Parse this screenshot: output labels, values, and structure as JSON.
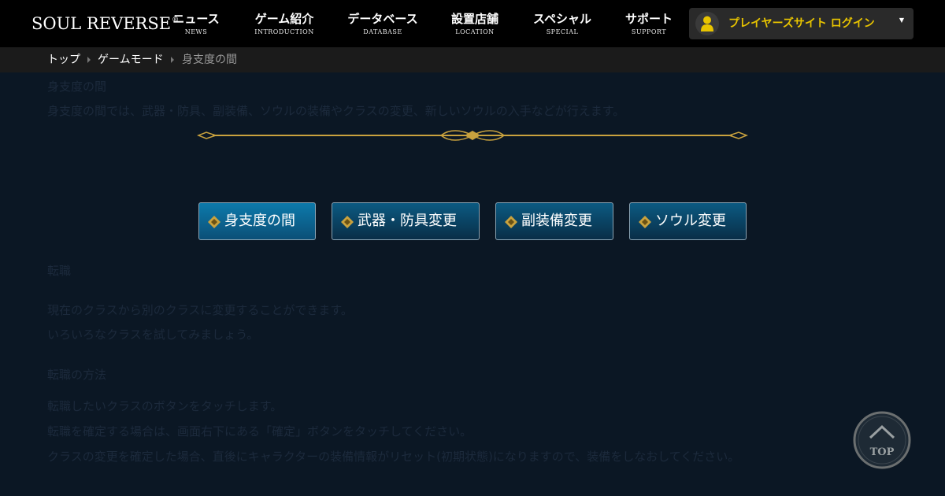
{
  "header": {
    "logo_text": "SOUL REVERSE",
    "logo_mark": "®",
    "nav": [
      {
        "jp": "ニュース",
        "en": "NEWS"
      },
      {
        "jp": "ゲーム紹介",
        "en": "INTRODUCTION"
      },
      {
        "jp": "データベース",
        "en": "DATABASE"
      },
      {
        "jp": "設置店舗",
        "en": "LOCATION"
      },
      {
        "jp": "スペシャル",
        "en": "SPECIAL"
      },
      {
        "jp": "サポート",
        "en": "SUPPORT"
      }
    ],
    "login_label": "プレイヤーズサイト ログイン",
    "login_caret": "▼"
  },
  "breadcrumb": [
    {
      "label": "トップ"
    },
    {
      "label": "ゲームモード"
    },
    {
      "label": "身支度の間"
    }
  ],
  "content": {
    "section_title": "身支度の間",
    "section_desc": "身支度の間では、武器・防具、副装備、ソウルの装備やクラスの変更、新しいソウルの入手などが行えます。",
    "tabs": [
      {
        "label": "身支度の間",
        "active": true
      },
      {
        "label": "武器・防具変更",
        "active": false
      },
      {
        "label": "副装備変更",
        "active": false
      },
      {
        "label": "ソウル変更",
        "active": false
      }
    ],
    "heading1": "転職",
    "para1": [
      "現在のクラスから別のクラスに変更することができます。",
      "いろいろなクラスを試してみましょう。"
    ],
    "heading2": "転職の方法",
    "para2": [
      "転職したいクラスのボタンをタッチします。",
      "転職を確定する場合は、画面右下にある「確定」ボタンをタッチしてください。",
      "クラスの変更を確定した場合、直後にキャラクターの装備情報がリセット(初期状態)になりますので、装備をしなおしてください。"
    ]
  },
  "top_button": {
    "label": "TOP"
  },
  "colors": {
    "background": "#0b1724",
    "header": "#000000",
    "breadcrumb": "#1b1b1b",
    "accent_gold": "#e8c400",
    "button_blue": "#0b5a82"
  }
}
